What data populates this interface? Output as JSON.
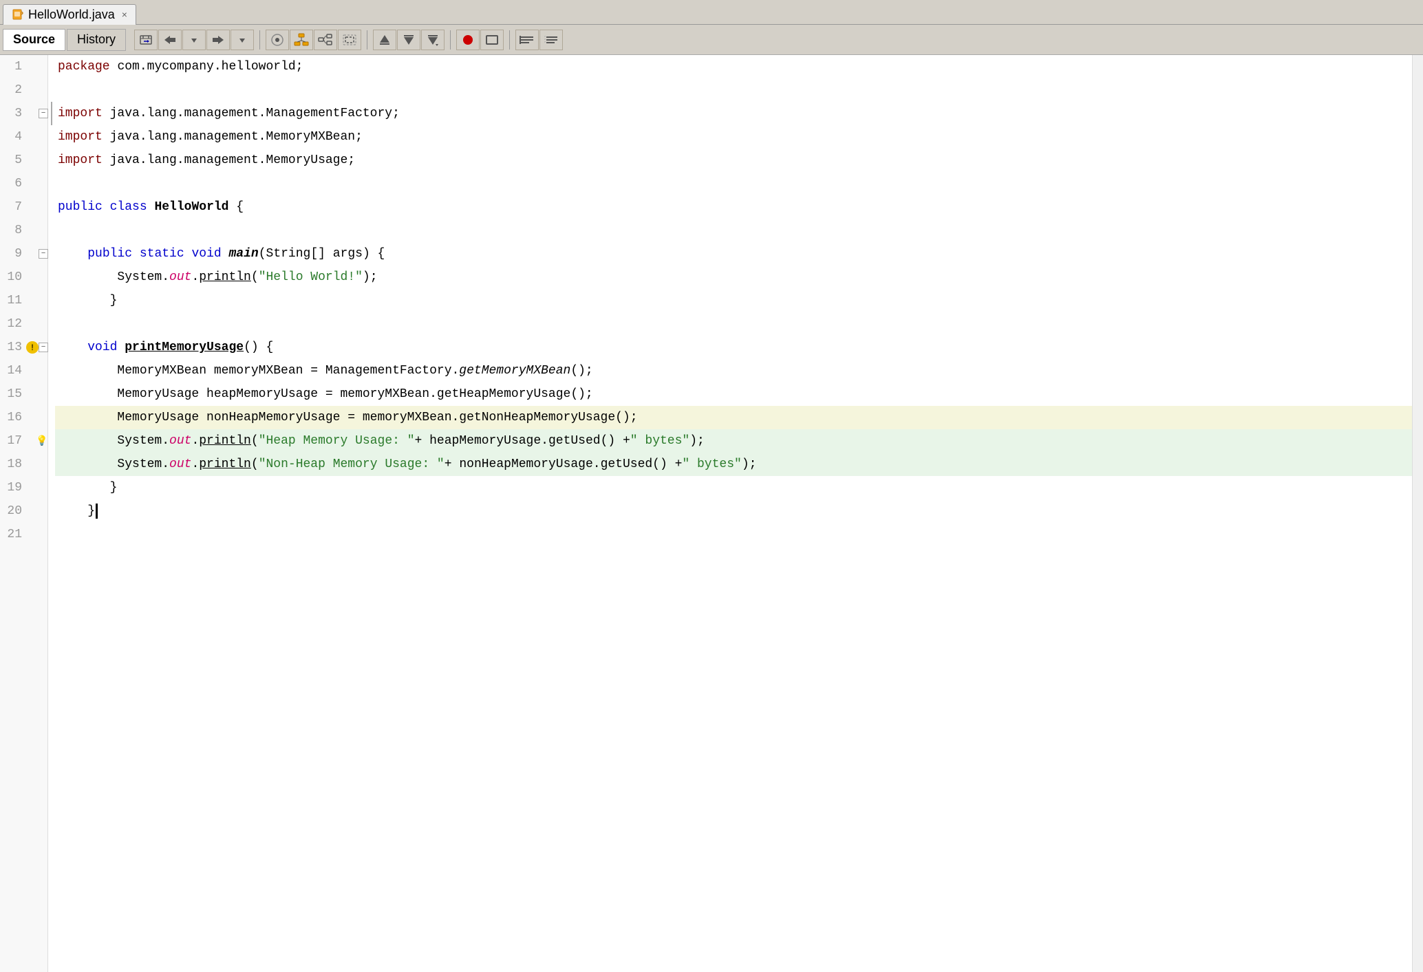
{
  "tab": {
    "filename": "HelloWorld.java",
    "close_label": "×"
  },
  "toolbar": {
    "source_label": "Source",
    "history_label": "History"
  },
  "code": {
    "lines": [
      {
        "num": 1,
        "content": "package",
        "type": "package"
      },
      {
        "num": 2,
        "content": "",
        "type": "empty"
      },
      {
        "num": 3,
        "content": "import_block_start",
        "type": "import"
      },
      {
        "num": 4,
        "content": "import java.lang.management.MemoryMXBean;",
        "type": "import"
      },
      {
        "num": 5,
        "content": "import java.lang.management.MemoryUsage;",
        "type": "import"
      },
      {
        "num": 6,
        "content": "",
        "type": "empty"
      },
      {
        "num": 7,
        "content": "public class HelloWorld {",
        "type": "class"
      },
      {
        "num": 8,
        "content": "",
        "type": "empty"
      },
      {
        "num": 9,
        "content": "main_method",
        "type": "method"
      },
      {
        "num": 10,
        "content": "System.out.println",
        "type": "println"
      },
      {
        "num": 11,
        "content": "    }",
        "type": "brace"
      },
      {
        "num": 12,
        "content": "",
        "type": "empty"
      },
      {
        "num": 13,
        "content": "printMemoryUsage",
        "type": "method2"
      },
      {
        "num": 14,
        "content": "MemoryMXBean memoryMXBean = ManagementFactory.getMemoryMXBean();",
        "type": "code"
      },
      {
        "num": 15,
        "content": "MemoryUsage heapMemoryUsage = memoryMXBean.getHeapMemoryUsage();",
        "type": "code"
      },
      {
        "num": 16,
        "content": "MemoryUsage nonHeapMemoryUsage = memoryMXBean.getNonHeapMemoryUsage();",
        "type": "code",
        "highlight": "yellow"
      },
      {
        "num": 17,
        "content": "System.out.println Heap",
        "type": "println2",
        "highlight": "green"
      },
      {
        "num": 18,
        "content": "System.out.println NonHeap",
        "type": "println3",
        "highlight": "green"
      },
      {
        "num": 19,
        "content": "    }",
        "type": "brace"
      },
      {
        "num": 20,
        "content": "}",
        "type": "brace_end"
      },
      {
        "num": 21,
        "content": "",
        "type": "empty"
      }
    ]
  }
}
